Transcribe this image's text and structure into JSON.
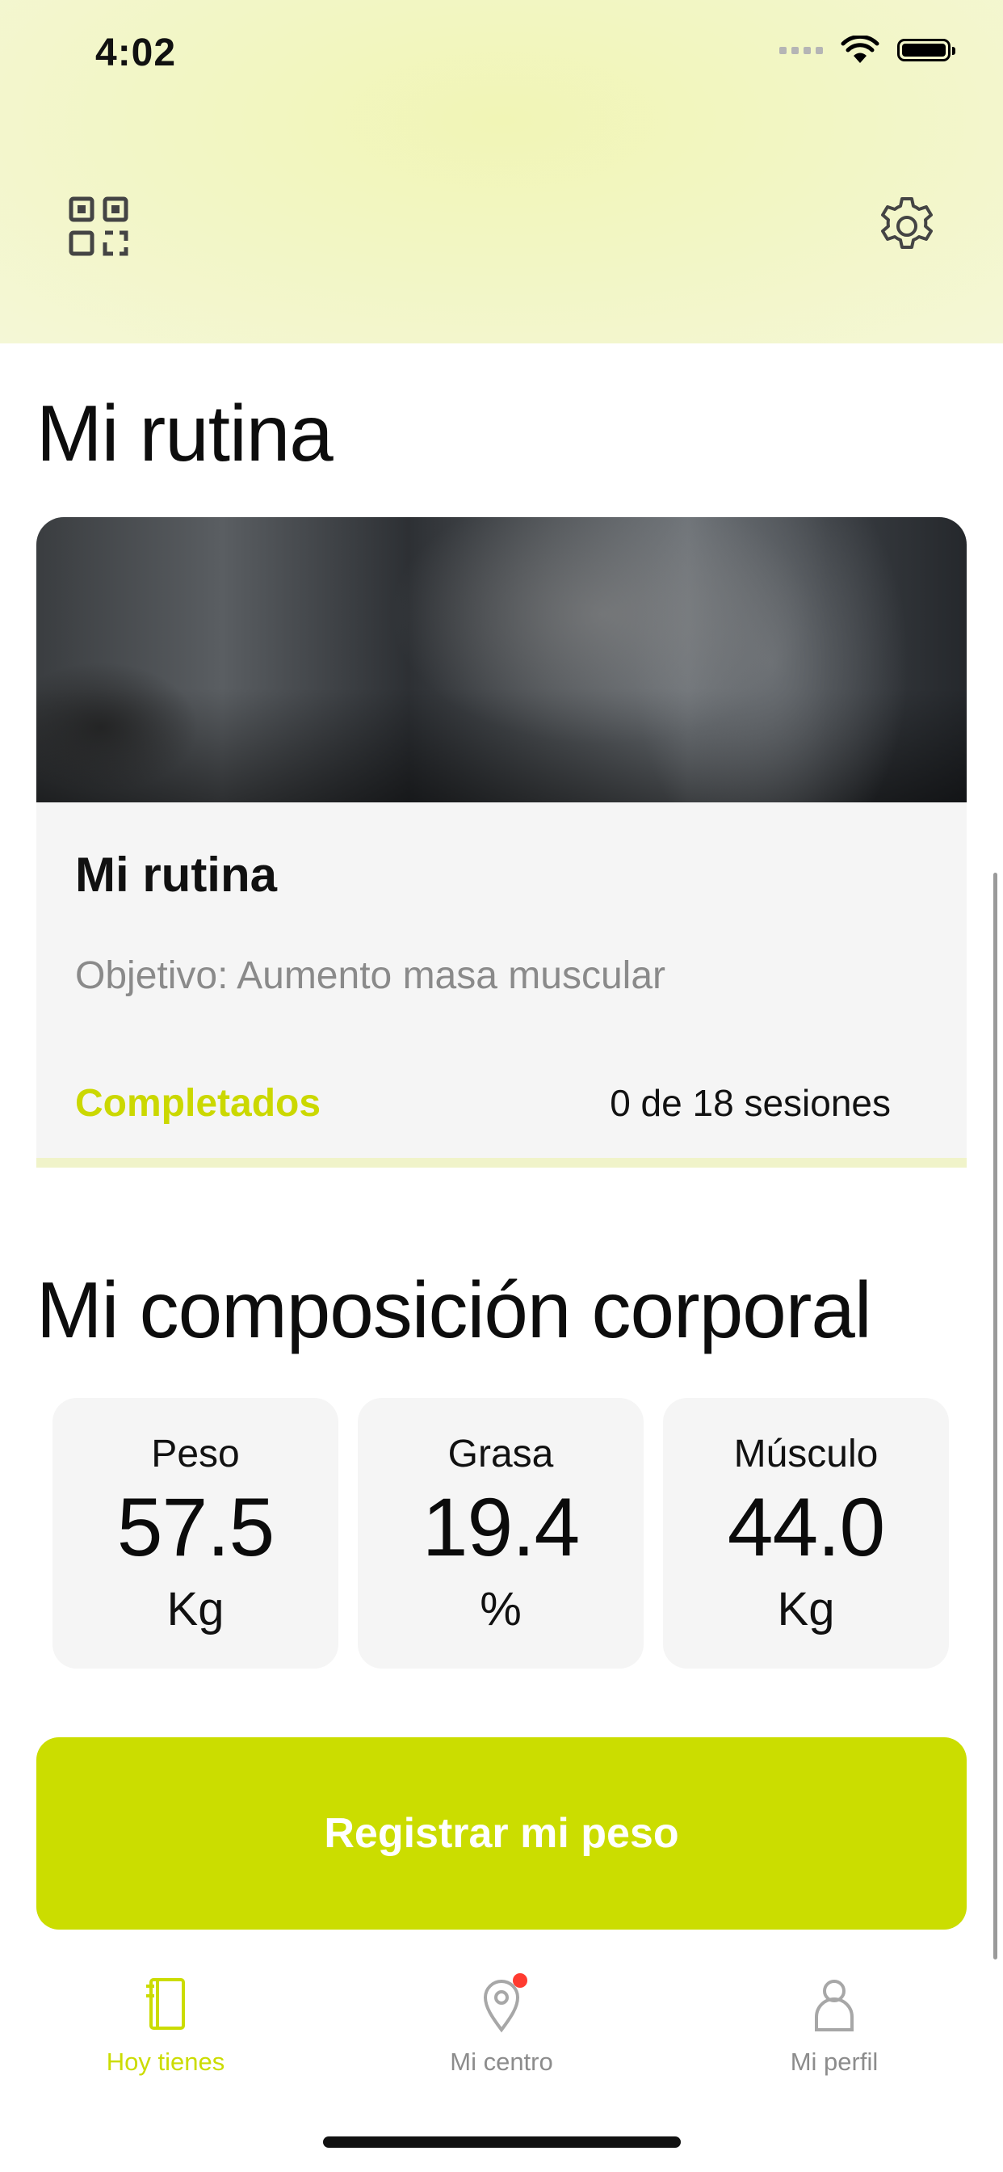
{
  "status_bar": {
    "time": "4:02"
  },
  "header": {
    "qr_icon": "qr-code-icon",
    "settings_icon": "gear-icon"
  },
  "routine_section": {
    "title": "Mi rutina",
    "card": {
      "title": "Mi rutina",
      "subtitle": "Objetivo: Aumento masa muscular",
      "completed_label": "Completados",
      "sessions_text": "0 de 18 sesiones",
      "progress_fraction": 0.0
    }
  },
  "composition_section": {
    "title": "Mi composición corporal",
    "metrics": [
      {
        "label": "Peso",
        "value": "57.5",
        "unit": "Kg"
      },
      {
        "label": "Grasa",
        "value": "19.4",
        "unit": "%"
      },
      {
        "label": "Músculo",
        "value": "44.0",
        "unit": "Kg"
      }
    ]
  },
  "primary_button": {
    "label": "Registrar mi peso"
  },
  "tabbar": {
    "tabs": [
      {
        "label": "Hoy tienes",
        "icon": "notebook-icon",
        "active": true
      },
      {
        "label": "Mi centro",
        "icon": "map-pin-icon",
        "active": false,
        "badge": true
      },
      {
        "label": "Mi perfil",
        "icon": "person-icon",
        "active": false
      }
    ]
  },
  "colors": {
    "accent": "#cbdd00",
    "header_bg": "#f2f6c4",
    "card_bg": "#f5f5f5",
    "badge": "#ff3b30"
  }
}
